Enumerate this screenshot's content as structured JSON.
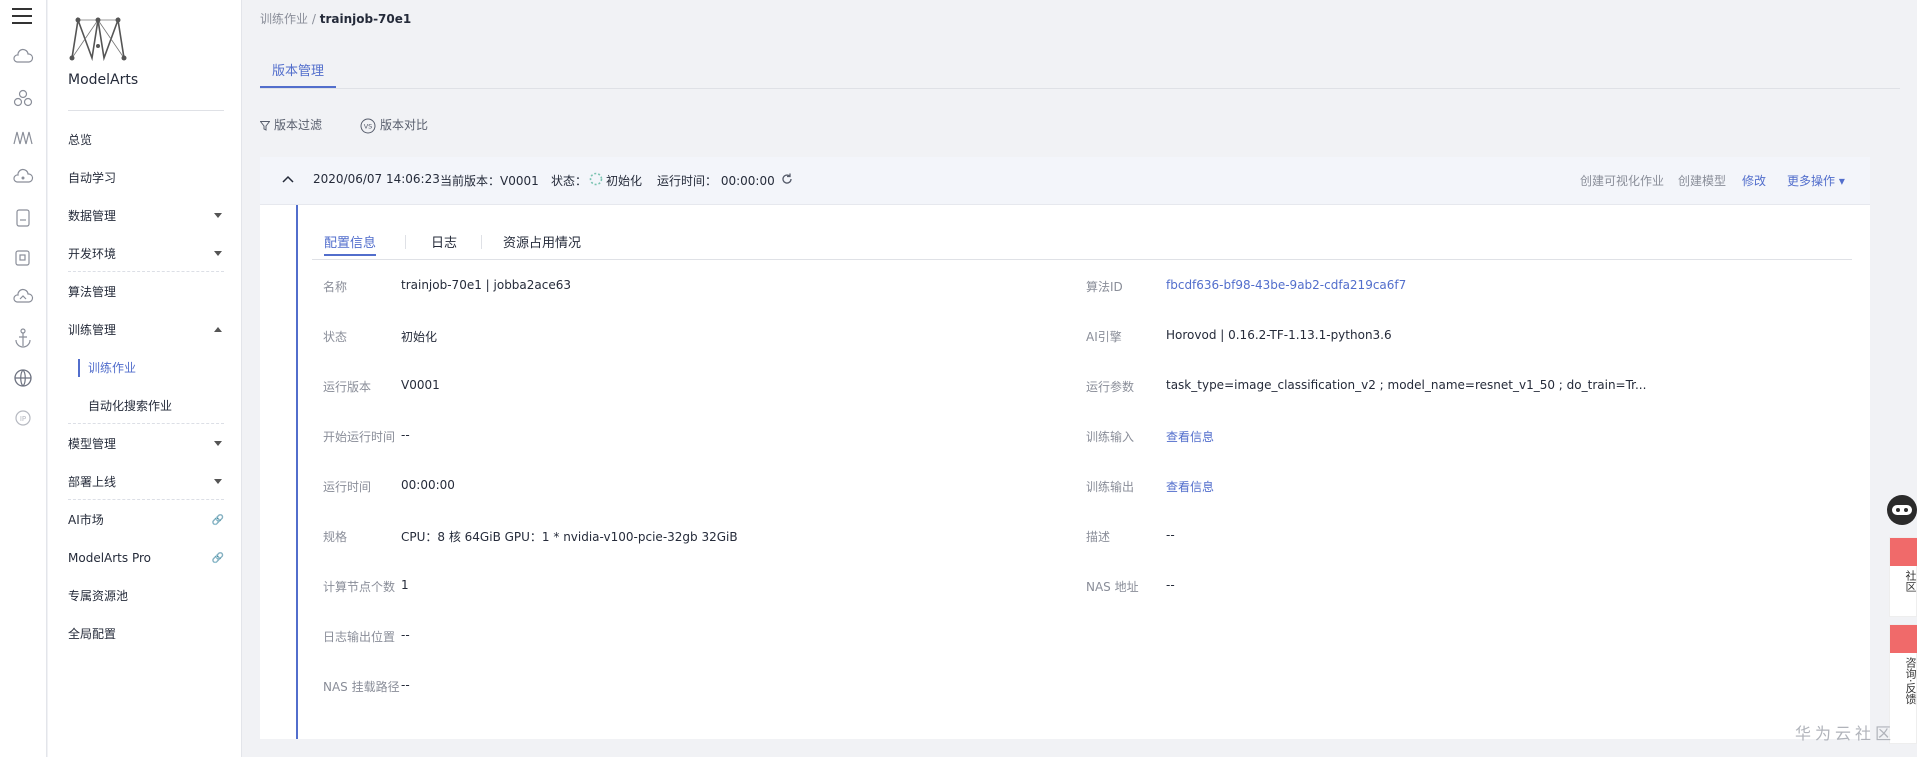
{
  "nav": {
    "logo_text": "ModelArts",
    "items": [
      {
        "label": "总览"
      },
      {
        "label": "自动学习"
      },
      {
        "label": "数据管理"
      },
      {
        "label": "开发环境"
      },
      {
        "label": "算法管理"
      },
      {
        "label": "训练管理"
      },
      {
        "label": "模型管理"
      },
      {
        "label": "部署上线"
      },
      {
        "label": "AI市场"
      },
      {
        "label": "ModelArts Pro"
      },
      {
        "label": "专属资源池"
      },
      {
        "label": "全局配置"
      }
    ],
    "sub_items": [
      {
        "label": "训练作业"
      },
      {
        "label": "自动化搜索作业"
      }
    ]
  },
  "breadcrumb": {
    "parent": "训练作业",
    "sep": "/",
    "current": "trainjob-70e1"
  },
  "page_tab": "版本管理",
  "toolbar": {
    "filter": "版本过滤",
    "compare": "版本对比",
    "compare_icon": "VS"
  },
  "version": {
    "datetime": "2020/06/07 14:06:23",
    "current_version": "当前版本：V0001",
    "status_label": "状态：",
    "status_value": "初始化",
    "runtime": "运行时间： 00:00:00",
    "actions": [
      "创建可视化作业",
      "创建模型",
      "修改",
      "更多操作"
    ]
  },
  "inner_tabs": [
    "配置信息",
    "日志",
    "资源占用情况"
  ],
  "details_left": [
    {
      "label": "名称",
      "value": "trainjob-70e1 | jobba2ace63"
    },
    {
      "label": "状态",
      "value": "初始化"
    },
    {
      "label": "运行版本",
      "value": "V0001"
    },
    {
      "label": "开始运行时间",
      "value": "--"
    },
    {
      "label": "运行时间",
      "value": "00:00:00"
    },
    {
      "label": "规格",
      "value": "CPU：8 核 64GiB GPU：1 * nvidia-v100-pcie-32gb 32GiB"
    },
    {
      "label": "计算节点个数",
      "value": "1"
    },
    {
      "label": "日志输出位置",
      "value": "--"
    },
    {
      "label": "NAS 挂载路径",
      "value": "--"
    }
  ],
  "details_right": [
    {
      "label": "算法ID",
      "value": "fbcdf636-bf98-43be-9ab2-cdfa219ca6f7"
    },
    {
      "label": "AI引擎",
      "value": "Horovod | 0.16.2-TF-1.13.1-python3.6"
    },
    {
      "label": "运行参数",
      "value": "task_type=image_classification_v2 ; model_name=resnet_v1_50 ; do_train=Tr..."
    },
    {
      "label": "训练输入",
      "value": "查看信息"
    },
    {
      "label": "训练输出",
      "value": "查看信息"
    },
    {
      "label": "描述",
      "value": "--"
    },
    {
      "label": "NAS 地址",
      "value": "--"
    }
  ],
  "float": {
    "community": "社区",
    "feedback": "咨询·反馈"
  },
  "watermark": "华为云社区",
  "colors": {
    "accent": "#526ecc",
    "float_red": "#f06a6a"
  }
}
